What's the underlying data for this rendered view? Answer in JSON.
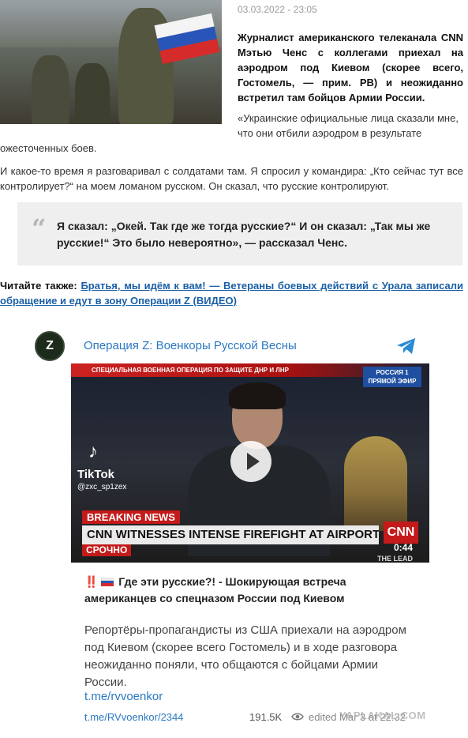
{
  "article": {
    "date": "03.03.2022 - 23:05",
    "lead": "Журналист американского телеканала CNN Мэтью Ченс с коллегами приехал на аэродром под Киевом (скорее всего, Гостомель, — прим. РВ) и неожиданно встретил там бойцов Армии России.",
    "p1": "«Украинские официальные лица сказали мне, что они отбили аэродром в результате ожесточенных боев.",
    "p2": "И какое-то время я разговаривал с солдатами там. Я спросил у командира: „Кто сейчас тут все контролирует?“ на моем ломаном русском. Он сказал, что русские контролируют.",
    "quote": "Я сказал: „Окей. Так где же тогда русские?“ И он сказал: „Так мы же русские!“ Это было невероятно», — рассказал Ченс.",
    "also_label": "Читайте также:",
    "also_link": "Братья, мы идём к вам! — Ветераны боевых действий с Урала записали обращение и едут в зону Операции Z (ВИДЕО)"
  },
  "telegram": {
    "avatar_letter": "Z",
    "channel": "Операция Z: Военкоры Русской Весны",
    "video": {
      "top_banner": "СПЕЦИАЛЬНАЯ ВОЕННАЯ ОПЕРАЦИЯ ПО ЗАЩИТЕ ДНР И ЛНР",
      "channel_badge": "РОССИЯ 1 ПРЯМОЙ ЭФИР",
      "tiktok": "TikTok",
      "tiktok_user": "@zxc_sp1zex",
      "breaking": "BREAKING NEWS",
      "headline": "CNN WITNESSES INTENSE FIREFIGHT AT AIRPORT OUTSIDE KYIV",
      "cnn": "CNN",
      "urgent": "СРОЧНО",
      "duration": "0:44",
      "show": "THE LEAD"
    },
    "post_title_marks": "‼️",
    "post_title": "Где эти русские?! - Шокирующая встреча американцев со спецназом России под Киевом",
    "post_body": "Репортёры-пропагандисты из США приехали на аэродром под Киевом (скорее всего Гостомель) и в ходе разговора неожиданно поняли, что общаются с бойцами Армии России.",
    "post_link": "t.me/rvvoenkor",
    "footer_url": "t.me/RVvoenkor/2344",
    "views": "191.5K",
    "edited": "edited Mar 3 at 22:32"
  },
  "watermark": "YAPLAKAL.COM",
  "colors": {
    "link": "#2a78c2",
    "accent_red": "#c41a1a"
  }
}
